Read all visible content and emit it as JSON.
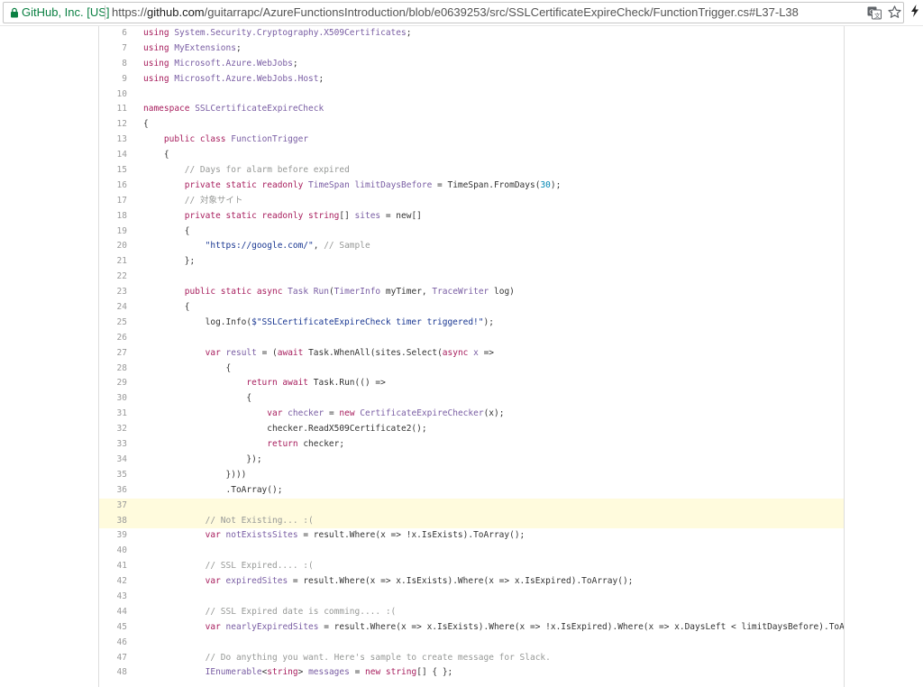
{
  "browser": {
    "secure_label": "GitHub, Inc. [US]",
    "url_scheme": "https://",
    "url_host": "github.com",
    "url_path": "/guitarrapc/AzureFunctionsIntroduction/blob/e0639253/src/SSLCertificateExpireCheck/FunctionTrigger.cs#L37-L38",
    "icons": [
      "lock-icon",
      "translate-icon",
      "star-icon",
      "extension-icon"
    ]
  },
  "code": {
    "highlighted_lines": [
      37,
      38
    ],
    "lines": [
      {
        "n": "6",
        "tokens": [
          [
            "k",
            "using "
          ],
          [
            "t",
            "System.Security.Cryptography.X509Certificates"
          ],
          [
            "e",
            ";"
          ]
        ]
      },
      {
        "n": "7",
        "tokens": [
          [
            "k",
            "using "
          ],
          [
            "t",
            "MyExtensions"
          ],
          [
            "e",
            ";"
          ]
        ]
      },
      {
        "n": "8",
        "tokens": [
          [
            "k",
            "using "
          ],
          [
            "t",
            "Microsoft.Azure.WebJobs"
          ],
          [
            "e",
            ";"
          ]
        ]
      },
      {
        "n": "9",
        "tokens": [
          [
            "k",
            "using "
          ],
          [
            "t",
            "Microsoft.Azure.WebJobs.Host"
          ],
          [
            "e",
            ";"
          ]
        ]
      },
      {
        "n": "10",
        "tokens": []
      },
      {
        "n": "11",
        "tokens": [
          [
            "k",
            "namespace "
          ],
          [
            "t",
            "SSLCertificateExpireCheck"
          ]
        ]
      },
      {
        "n": "12",
        "tokens": [
          [
            "e",
            "{"
          ]
        ]
      },
      {
        "n": "13",
        "tokens": [
          [
            "e",
            "    "
          ],
          [
            "k",
            "public class "
          ],
          [
            "t",
            "FunctionTrigger"
          ]
        ]
      },
      {
        "n": "14",
        "tokens": [
          [
            "e",
            "    {"
          ]
        ]
      },
      {
        "n": "15",
        "tokens": [
          [
            "e",
            "        "
          ],
          [
            "c",
            "// Days for alarm before expired"
          ]
        ]
      },
      {
        "n": "16",
        "tokens": [
          [
            "e",
            "        "
          ],
          [
            "k",
            "private static readonly "
          ],
          [
            "t",
            "TimeSpan "
          ],
          [
            "t",
            "limitDaysBefore"
          ],
          [
            "e",
            " = TimeSpan.FromDays("
          ],
          [
            "n",
            "30"
          ],
          [
            "e",
            ");"
          ]
        ]
      },
      {
        "n": "17",
        "tokens": [
          [
            "e",
            "        "
          ],
          [
            "c",
            "// 対象サイト"
          ]
        ]
      },
      {
        "n": "18",
        "tokens": [
          [
            "e",
            "        "
          ],
          [
            "k",
            "private static readonly string"
          ],
          [
            "e",
            "[] "
          ],
          [
            "t",
            "sites"
          ],
          [
            "e",
            " = new[]"
          ]
        ]
      },
      {
        "n": "19",
        "tokens": [
          [
            "e",
            "        {"
          ]
        ]
      },
      {
        "n": "20",
        "tokens": [
          [
            "e",
            "            "
          ],
          [
            "s",
            "\"https://google.com/\""
          ],
          [
            "e",
            ", "
          ],
          [
            "c",
            "// Sample"
          ]
        ]
      },
      {
        "n": "21",
        "tokens": [
          [
            "e",
            "        };"
          ]
        ]
      },
      {
        "n": "22",
        "tokens": []
      },
      {
        "n": "23",
        "tokens": [
          [
            "e",
            "        "
          ],
          [
            "k",
            "public static async "
          ],
          [
            "t",
            "Task "
          ],
          [
            "t",
            "Run"
          ],
          [
            "e",
            "("
          ],
          [
            "t",
            "TimerInfo"
          ],
          [
            "e",
            " myTimer, "
          ],
          [
            "t",
            "TraceWriter"
          ],
          [
            "e",
            " log)"
          ]
        ]
      },
      {
        "n": "24",
        "tokens": [
          [
            "e",
            "        {"
          ]
        ]
      },
      {
        "n": "25",
        "tokens": [
          [
            "e",
            "            log.Info("
          ],
          [
            "s",
            "$\"SSLCertificateExpireCheck timer triggered!\""
          ],
          [
            "e",
            ");"
          ]
        ]
      },
      {
        "n": "26",
        "tokens": []
      },
      {
        "n": "27",
        "tokens": [
          [
            "e",
            "            "
          ],
          [
            "k",
            "var "
          ],
          [
            "t",
            "result"
          ],
          [
            "e",
            " = ("
          ],
          [
            "k",
            "await "
          ],
          [
            "e",
            "Task.WhenAll(sites.Select("
          ],
          [
            "k",
            "async "
          ],
          [
            "t",
            "x"
          ],
          [
            "e",
            " =>"
          ]
        ]
      },
      {
        "n": "28",
        "tokens": [
          [
            "e",
            "                {"
          ]
        ]
      },
      {
        "n": "29",
        "tokens": [
          [
            "e",
            "                    "
          ],
          [
            "k",
            "return await "
          ],
          [
            "e",
            "Task.Run(() =>"
          ]
        ]
      },
      {
        "n": "30",
        "tokens": [
          [
            "e",
            "                    {"
          ]
        ]
      },
      {
        "n": "31",
        "tokens": [
          [
            "e",
            "                        "
          ],
          [
            "k",
            "var "
          ],
          [
            "t",
            "checker"
          ],
          [
            "e",
            " = "
          ],
          [
            "k",
            "new "
          ],
          [
            "t",
            "CertificateExpireChecker"
          ],
          [
            "e",
            "(x);"
          ]
        ]
      },
      {
        "n": "32",
        "tokens": [
          [
            "e",
            "                        checker.ReadX509Certificate2();"
          ]
        ]
      },
      {
        "n": "33",
        "tokens": [
          [
            "e",
            "                        "
          ],
          [
            "k",
            "return "
          ],
          [
            "e",
            "checker;"
          ]
        ]
      },
      {
        "n": "34",
        "tokens": [
          [
            "e",
            "                    });"
          ]
        ]
      },
      {
        "n": "35",
        "tokens": [
          [
            "e",
            "                })))"
          ]
        ]
      },
      {
        "n": "36",
        "tokens": [
          [
            "e",
            "                .ToArray();"
          ]
        ]
      },
      {
        "n": "37",
        "tokens": []
      },
      {
        "n": "38",
        "tokens": [
          [
            "e",
            "            "
          ],
          [
            "c",
            "// Not Existing... :("
          ]
        ]
      },
      {
        "n": "39",
        "tokens": [
          [
            "e",
            "            "
          ],
          [
            "k",
            "var "
          ],
          [
            "t",
            "notExistsSites"
          ],
          [
            "e",
            " = result.Where(x => !x.IsExists).ToArray();"
          ]
        ]
      },
      {
        "n": "40",
        "tokens": []
      },
      {
        "n": "41",
        "tokens": [
          [
            "e",
            "            "
          ],
          [
            "c",
            "// SSL Expired.... :("
          ]
        ]
      },
      {
        "n": "42",
        "tokens": [
          [
            "e",
            "            "
          ],
          [
            "k",
            "var "
          ],
          [
            "t",
            "expiredSites"
          ],
          [
            "e",
            " = result.Where(x => x.IsExists).Where(x => x.IsExpired).ToArray();"
          ]
        ]
      },
      {
        "n": "43",
        "tokens": []
      },
      {
        "n": "44",
        "tokens": [
          [
            "e",
            "            "
          ],
          [
            "c",
            "// SSL Expired date is comming.... :("
          ]
        ]
      },
      {
        "n": "45",
        "tokens": [
          [
            "e",
            "            "
          ],
          [
            "k",
            "var "
          ],
          [
            "t",
            "nearlyExpiredSites"
          ],
          [
            "e",
            " = result.Where(x => x.IsExists).Where(x => !x.IsExpired).Where(x => x.DaysLeft < limitDaysBefore).ToArray"
          ]
        ]
      },
      {
        "n": "46",
        "tokens": []
      },
      {
        "n": "47",
        "tokens": [
          [
            "e",
            "            "
          ],
          [
            "c",
            "// Do anything you want. Here's sample to create message for Slack."
          ]
        ]
      },
      {
        "n": "48",
        "tokens": [
          [
            "e",
            "            "
          ],
          [
            "t",
            "IEnumerable"
          ],
          [
            "e",
            "<"
          ],
          [
            "k",
            "string"
          ],
          [
            "e",
            "> "
          ],
          [
            "t",
            "messages"
          ],
          [
            "e",
            " = "
          ],
          [
            "k",
            "new string"
          ],
          [
            "e",
            "[] { };"
          ]
        ]
      }
    ]
  }
}
